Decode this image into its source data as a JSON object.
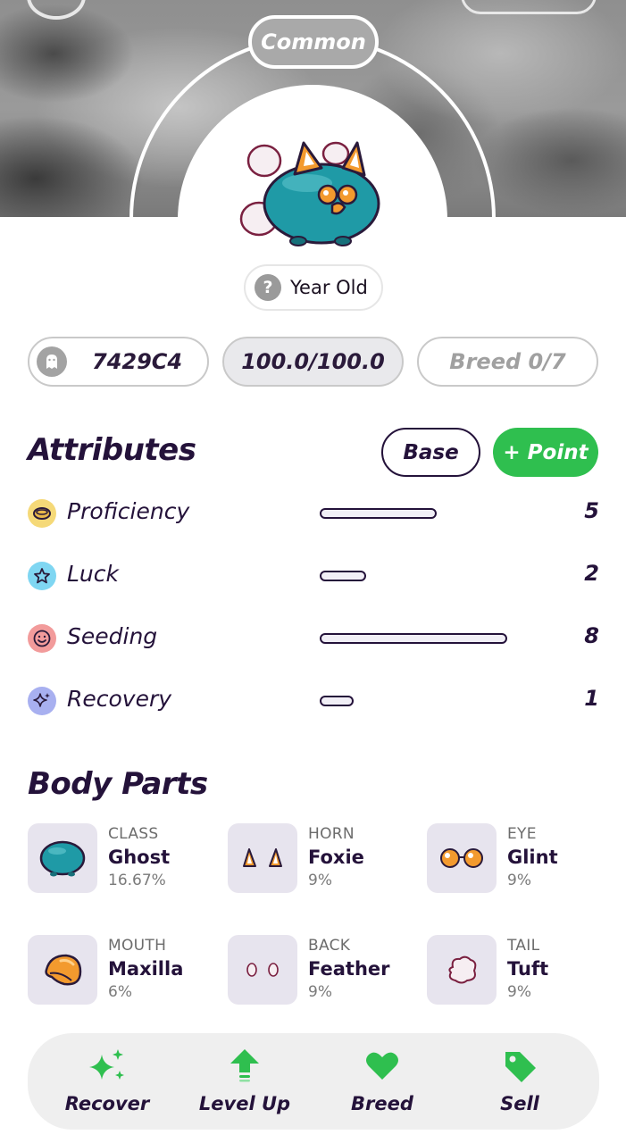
{
  "header": {
    "rarity": "Common",
    "age_label": "Year Old",
    "age_icon": "question-icon"
  },
  "stats": {
    "id": "7429C4",
    "id_icon": "ghost-icon",
    "health": "100.0/100.0",
    "breed": "Breed 0/7"
  },
  "attributes": {
    "title": "Attributes",
    "base_label": "Base",
    "point_label": "+ Point",
    "max_value": 10,
    "items": [
      {
        "name": "Proficiency",
        "value": "5",
        "level": 5,
        "icon": "coin-icon",
        "color": "#f5d978"
      },
      {
        "name": "Luck",
        "value": "2",
        "level": 2,
        "icon": "star-icon",
        "color": "#7fd6f2"
      },
      {
        "name": "Seeding",
        "value": "8",
        "level": 8,
        "icon": "smile-icon",
        "color": "#f29b9b"
      },
      {
        "name": "Recovery",
        "value": "1",
        "level": 1,
        "icon": "sparkle-icon",
        "color": "#a8b0f0"
      }
    ]
  },
  "body_parts": {
    "title": "Body Parts",
    "items": [
      {
        "type": "CLASS",
        "name": "Ghost",
        "pct": "16.67%",
        "icon": "ghost-body-icon"
      },
      {
        "type": "HORN",
        "name": "Foxie",
        "pct": "9%",
        "icon": "fox-ears-icon"
      },
      {
        "type": "EYE",
        "name": "Glint",
        "pct": "9%",
        "icon": "glasses-icon"
      },
      {
        "type": "MOUTH",
        "name": "Maxilla",
        "pct": "6%",
        "icon": "beak-icon"
      },
      {
        "type": "BACK",
        "name": "Feather",
        "pct": "9%",
        "icon": "feather-icon"
      },
      {
        "type": "TAIL",
        "name": "Tuft",
        "pct": "9%",
        "icon": "tuft-icon"
      }
    ]
  },
  "actions": [
    {
      "label": "Recover",
      "icon": "sparkles-icon"
    },
    {
      "label": "Level Up",
      "icon": "arrow-up-icon"
    },
    {
      "label": "Breed",
      "icon": "heart-icon"
    },
    {
      "label": "Sell",
      "icon": "tag-icon"
    }
  ],
  "colors": {
    "accent_green": "#2fbf4f",
    "text_dark": "#24123a",
    "teal": "#1f9aa6"
  }
}
